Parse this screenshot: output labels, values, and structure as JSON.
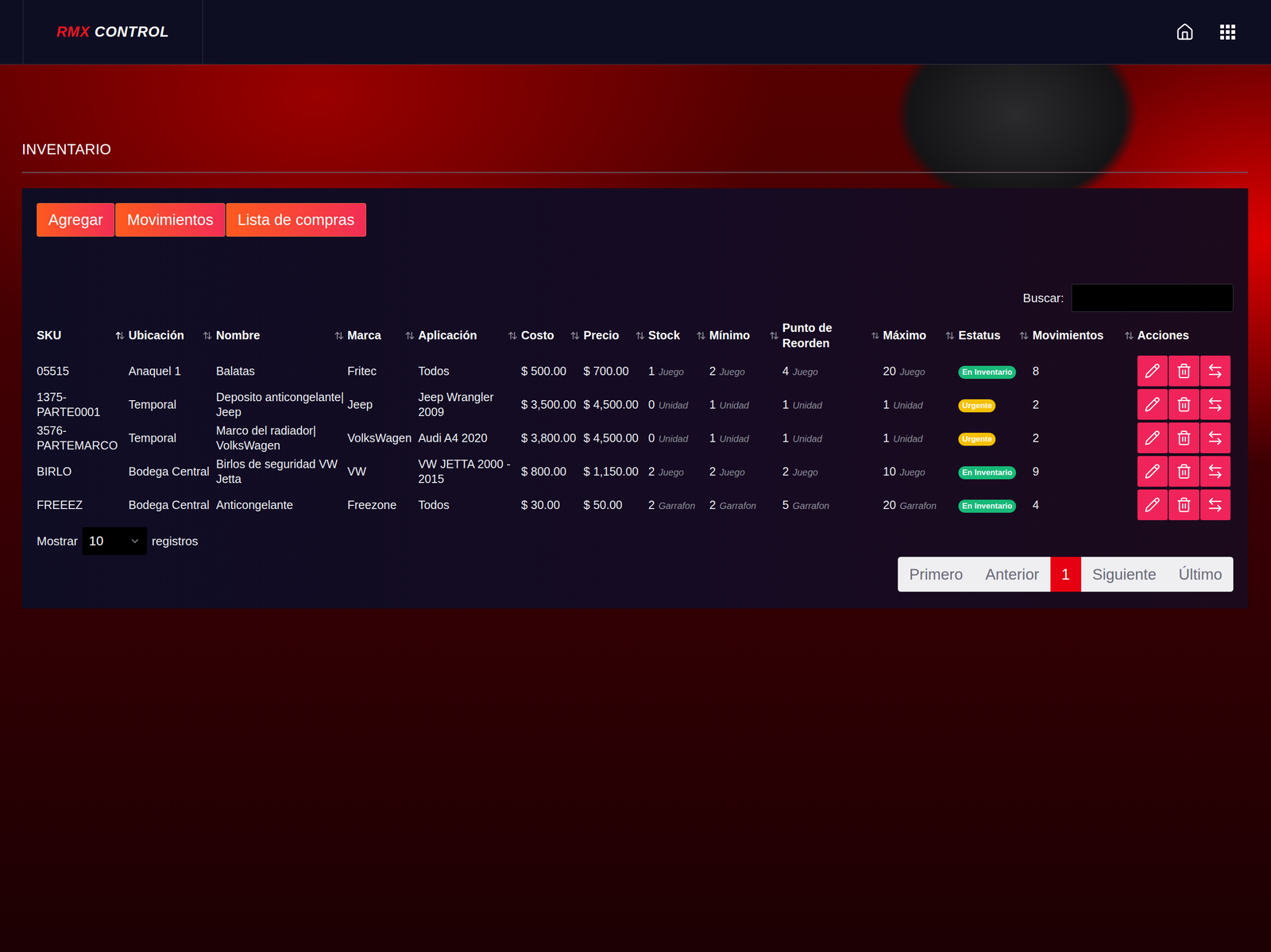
{
  "header": {
    "brand_accent": "RMX",
    "brand": "CONTROL"
  },
  "page": {
    "title": "INVENTARIO"
  },
  "toolbar": {
    "buttons": [
      "Agregar",
      "Movimientos",
      "Lista de compras"
    ]
  },
  "search": {
    "label": "Buscar:",
    "value": ""
  },
  "table": {
    "columns": [
      {
        "label": "SKU",
        "sortable": true,
        "sort": "asc"
      },
      {
        "label": "Ubicación",
        "sortable": true,
        "sort": "none"
      },
      {
        "label": "Nombre",
        "sortable": true,
        "sort": "none"
      },
      {
        "label": "Marca",
        "sortable": true,
        "sort": "none"
      },
      {
        "label": "Aplicación",
        "sortable": true,
        "sort": "none"
      },
      {
        "label": "Costo",
        "sortable": true,
        "sort": "none"
      },
      {
        "label": "Precio",
        "sortable": true,
        "sort": "none"
      },
      {
        "label": "Stock",
        "sortable": true,
        "sort": "none"
      },
      {
        "label": "Mínimo",
        "sortable": true,
        "sort": "none"
      },
      {
        "label": "Punto de Reorden",
        "sortable": true,
        "sort": "none"
      },
      {
        "label": "Máximo",
        "sortable": true,
        "sort": "none"
      },
      {
        "label": "Estatus",
        "sortable": true,
        "sort": "none"
      },
      {
        "label": "Movimientos",
        "sortable": true,
        "sort": "none"
      },
      {
        "label": "Acciones",
        "sortable": false,
        "sort": "none"
      }
    ],
    "rows": [
      {
        "sku": "05515",
        "location": "Anaquel 1",
        "name": "Balatas",
        "brand": "Fritec",
        "application": "Todos",
        "cost": "$ 500.00",
        "price": "$ 700.00",
        "stock": {
          "value": "1",
          "unit": "Juego"
        },
        "min": {
          "value": "2",
          "unit": "Juego"
        },
        "reorder": {
          "value": "4",
          "unit": "Juego"
        },
        "max": {
          "value": "20",
          "unit": "Juego"
        },
        "status": {
          "label": "En Inventario",
          "color": "#17b978"
        },
        "movements": "8"
      },
      {
        "sku": "1375-PARTE0001",
        "location": "Temporal",
        "name": "Deposito anticongelante| Jeep",
        "brand": "Jeep",
        "application": "Jeep Wrangler 2009",
        "cost": "$ 3,500.00",
        "price": "$ 4,500.00",
        "stock": {
          "value": "0",
          "unit": "Unidad"
        },
        "min": {
          "value": "1",
          "unit": "Unidad"
        },
        "reorder": {
          "value": "1",
          "unit": "Unidad"
        },
        "max": {
          "value": "1",
          "unit": "Unidad"
        },
        "status": {
          "label": "Urgente",
          "color": "#f5c000"
        },
        "movements": "2"
      },
      {
        "sku": "3576-PARTEMARCO",
        "location": "Temporal",
        "name": "Marco del radiador| VolksWagen",
        "brand": "VolksWagen",
        "application": "Audi A4 2020",
        "cost": "$ 3,800.00",
        "price": "$ 4,500.00",
        "stock": {
          "value": "0",
          "unit": "Unidad"
        },
        "min": {
          "value": "1",
          "unit": "Unidad"
        },
        "reorder": {
          "value": "1",
          "unit": "Unidad"
        },
        "max": {
          "value": "1",
          "unit": "Unidad"
        },
        "status": {
          "label": "Urgente",
          "color": "#f5c000"
        },
        "movements": "2"
      },
      {
        "sku": "BIRLO",
        "location": "Bodega Central",
        "name": "Birlos de seguridad VW Jetta",
        "brand": "VW",
        "application": "VW JETTA 2000 - 2015",
        "cost": "$ 800.00",
        "price": "$ 1,150.00",
        "stock": {
          "value": "2",
          "unit": "Juego"
        },
        "min": {
          "value": "2",
          "unit": "Juego"
        },
        "reorder": {
          "value": "2",
          "unit": "Juego"
        },
        "max": {
          "value": "10",
          "unit": "Juego"
        },
        "status": {
          "label": "En Inventario",
          "color": "#17b978"
        },
        "movements": "9"
      },
      {
        "sku": "FREEEZ",
        "location": "Bodega Central",
        "name": "Anticongelante",
        "brand": "Freezone",
        "application": "Todos",
        "cost": "$ 30.00",
        "price": "$ 50.00",
        "stock": {
          "value": "2",
          "unit": "Garrafon"
        },
        "min": {
          "value": "2",
          "unit": "Garrafon"
        },
        "reorder": {
          "value": "5",
          "unit": "Garrafon"
        },
        "max": {
          "value": "20",
          "unit": "Garrafon"
        },
        "status": {
          "label": "En Inventario",
          "color": "#17b978"
        },
        "movements": "4"
      }
    ]
  },
  "length": {
    "before": "Mostrar",
    "value": "10",
    "after": "registros"
  },
  "pagination": [
    {
      "label": "Primero",
      "selected": false
    },
    {
      "label": "Anterior",
      "selected": false
    },
    {
      "label": "1",
      "selected": true
    },
    {
      "label": "Siguiente",
      "selected": false
    },
    {
      "label": "Último",
      "selected": false
    }
  ]
}
